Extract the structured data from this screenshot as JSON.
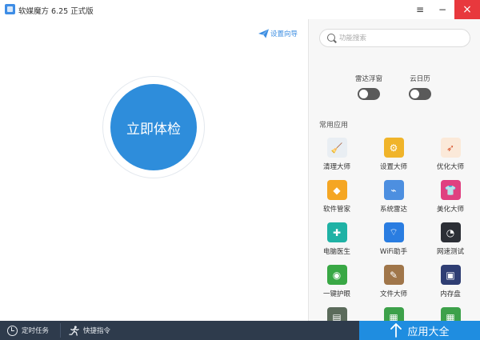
{
  "window": {
    "title": "软媒魔方 6.25 正式版",
    "menu_icon": "≡",
    "minimize_icon": "−",
    "close_icon": "×"
  },
  "main": {
    "wizard_link": "设置向导",
    "scan_button": "立即体检"
  },
  "sidebar": {
    "search_placeholder": "功能搜索",
    "toggles": [
      {
        "label": "雷达浮窗",
        "on": false
      },
      {
        "label": "云日历",
        "on": false
      }
    ],
    "section_title": "常用应用",
    "apps": [
      {
        "label": "清理大师",
        "icon": "broom-icon",
        "color": "#e9eef3"
      },
      {
        "label": "设置大师",
        "icon": "gear-icon",
        "color": "#f0b42a"
      },
      {
        "label": "优化大师",
        "icon": "rocket-icon",
        "color": "#fbe9d9"
      },
      {
        "label": "软件管家",
        "icon": "software-manager-icon",
        "color": "#f5a623"
      },
      {
        "label": "系统雷达",
        "icon": "satellite-dish-icon",
        "color": "#4d8fe0"
      },
      {
        "label": "美化大师",
        "icon": "tshirt-icon",
        "color": "#e04080"
      },
      {
        "label": "电脑医生",
        "icon": "medical-kit-icon",
        "color": "#1fb2a5"
      },
      {
        "label": "WiFi助手",
        "icon": "wifi-icon",
        "color": "#2a7de1"
      },
      {
        "label": "网速测试",
        "icon": "speedometer-icon",
        "color": "#2c2f36"
      },
      {
        "label": "一键护眼",
        "icon": "eye-icon",
        "color": "#39a845"
      },
      {
        "label": "文件大师",
        "icon": "file-tools-icon",
        "color": "#a0764a"
      },
      {
        "label": "内存盘",
        "icon": "memory-chip-icon",
        "color": "#2f3e73"
      },
      {
        "label": "",
        "icon": "partial-app-icon-1",
        "color": "#5b6b5b"
      },
      {
        "label": "",
        "icon": "partial-app-icon-2",
        "color": "#3da14a"
      },
      {
        "label": "",
        "icon": "partial-app-icon-3",
        "color": "#3da14a"
      }
    ]
  },
  "bottom": {
    "timer_tasks": "定时任务",
    "quick_commands": "快捷指令",
    "all_apps": "应用大全"
  }
}
